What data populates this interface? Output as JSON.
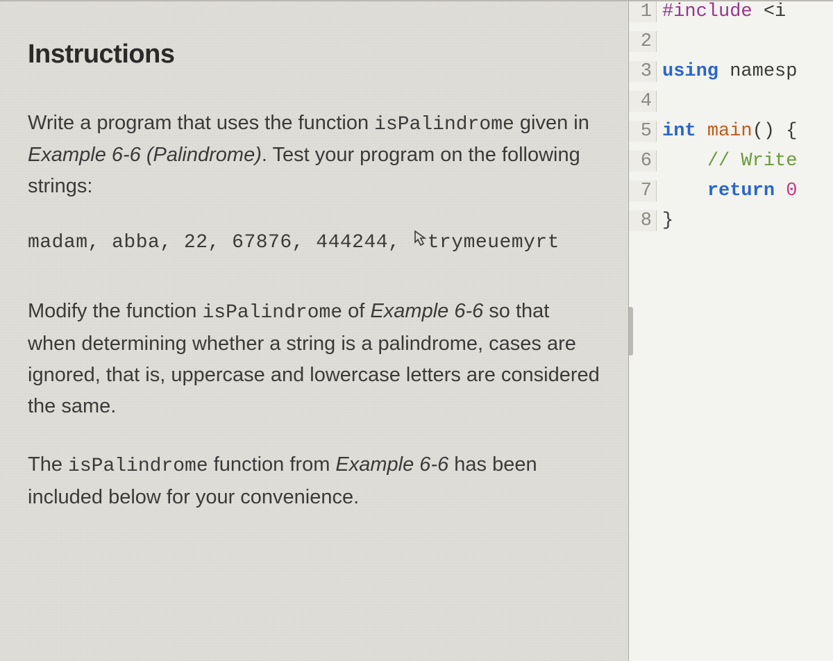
{
  "instructions": {
    "title": "Instructions",
    "para1_pre": "Write a program that uses the function ",
    "para1_code": "isPalindrome",
    "para1_mid": " given in ",
    "para1_em": "Example 6-6 (Palindrome)",
    "para1_post": ". Test your program on the following strings:",
    "test_strings_a": "madam, abba, 22, 67876, 444244, ",
    "test_strings_b": "trymeuemyrt",
    "para2_pre": "Modify the function ",
    "para2_code": "isPalindrome",
    "para2_mid": " of ",
    "para2_em": "Example 6-6",
    "para2_post": " so that when determining whether a string is a palindrome, cases are ignored, that is, uppercase and lowercase letters are considered the same.",
    "para3_pre": "The ",
    "para3_code": "isPalindrome",
    "para3_mid": " function from ",
    "para3_em": "Example 6-6",
    "para3_post": " has been included below for your convenience."
  },
  "code": {
    "line_nums": [
      "1",
      "2",
      "3",
      "4",
      "5",
      "6",
      "7",
      "8"
    ],
    "l1_a": "#include",
    "l1_b": " <i",
    "l3_a": "using",
    "l3_b": " namesp",
    "l5_a": "int",
    "l5_b": " ",
    "l5_c": "main",
    "l5_d": "() {",
    "l6_indent": "    ",
    "l6_cmt": "// Write",
    "l7_indent": "    ",
    "l7_a": "return",
    "l7_b": " ",
    "l7_c": "0",
    "l8": "}"
  }
}
